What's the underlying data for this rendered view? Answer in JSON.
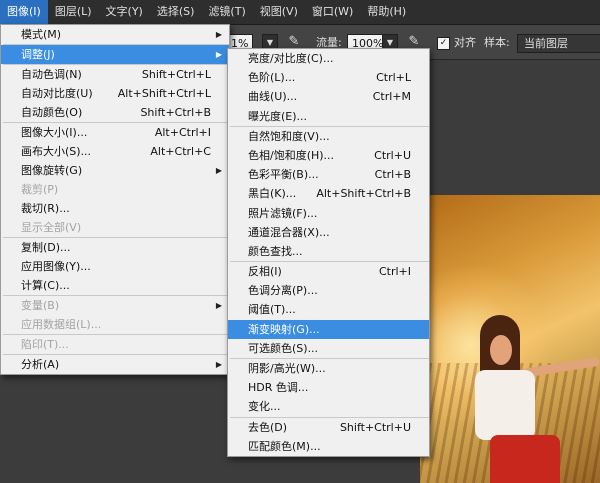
{
  "menubar": [
    {
      "label": "图像(I)",
      "active": true
    },
    {
      "label": "图层(L)",
      "active": false
    },
    {
      "label": "文字(Y)",
      "active": false
    },
    {
      "label": "选择(S)",
      "active": false
    },
    {
      "label": "滤镜(T)",
      "active": false
    },
    {
      "label": "视图(V)",
      "active": false
    },
    {
      "label": "窗口(W)",
      "active": false
    },
    {
      "label": "帮助(H)",
      "active": false
    }
  ],
  "options": {
    "opacity_value": "1%",
    "flow_label": "流量:",
    "flow_value": "100%",
    "align_label": "对齐",
    "align_checked": "✓",
    "sample_label": "样本:",
    "sample_value": "当前图层",
    "airbrush_icon": "airbrush-icon"
  },
  "image_menu": [
    {
      "type": "item",
      "label": "模式(M)",
      "arrow": true
    },
    {
      "type": "sep"
    },
    {
      "type": "item",
      "label": "调整(J)",
      "arrow": true,
      "hl": true
    },
    {
      "type": "sep"
    },
    {
      "type": "item",
      "label": "自动色调(N)",
      "shortcut": "Shift+Ctrl+L"
    },
    {
      "type": "item",
      "label": "自动对比度(U)",
      "shortcut": "Alt+Shift+Ctrl+L"
    },
    {
      "type": "item",
      "label": "自动颜色(O)",
      "shortcut": "Shift+Ctrl+B"
    },
    {
      "type": "sep"
    },
    {
      "type": "item",
      "label": "图像大小(I)...",
      "shortcut": "Alt+Ctrl+I"
    },
    {
      "type": "item",
      "label": "画布大小(S)...",
      "shortcut": "Alt+Ctrl+C"
    },
    {
      "type": "item",
      "label": "图像旋转(G)",
      "arrow": true
    },
    {
      "type": "item",
      "label": "裁剪(P)",
      "disabled": true
    },
    {
      "type": "item",
      "label": "裁切(R)..."
    },
    {
      "type": "item",
      "label": "显示全部(V)",
      "disabled": true
    },
    {
      "type": "sep"
    },
    {
      "type": "item",
      "label": "复制(D)..."
    },
    {
      "type": "item",
      "label": "应用图像(Y)..."
    },
    {
      "type": "item",
      "label": "计算(C)..."
    },
    {
      "type": "sep"
    },
    {
      "type": "item",
      "label": "变量(B)",
      "arrow": true,
      "disabled": true
    },
    {
      "type": "item",
      "label": "应用数据组(L)...",
      "disabled": true
    },
    {
      "type": "sep"
    },
    {
      "type": "item",
      "label": "陷印(T)...",
      "disabled": true
    },
    {
      "type": "sep"
    },
    {
      "type": "item",
      "label": "分析(A)",
      "arrow": true
    }
  ],
  "adjust_menu": [
    {
      "type": "item",
      "label": "亮度/对比度(C)..."
    },
    {
      "type": "item",
      "label": "色阶(L)...",
      "shortcut": "Ctrl+L"
    },
    {
      "type": "item",
      "label": "曲线(U)...",
      "shortcut": "Ctrl+M"
    },
    {
      "type": "item",
      "label": "曝光度(E)..."
    },
    {
      "type": "sep"
    },
    {
      "type": "item",
      "label": "自然饱和度(V)..."
    },
    {
      "type": "item",
      "label": "色相/饱和度(H)...",
      "shortcut": "Ctrl+U"
    },
    {
      "type": "item",
      "label": "色彩平衡(B)...",
      "shortcut": "Ctrl+B"
    },
    {
      "type": "item",
      "label": "黑白(K)...",
      "shortcut": "Alt+Shift+Ctrl+B"
    },
    {
      "type": "item",
      "label": "照片滤镜(F)..."
    },
    {
      "type": "item",
      "label": "通道混合器(X)..."
    },
    {
      "type": "item",
      "label": "颜色查找..."
    },
    {
      "type": "sep"
    },
    {
      "type": "item",
      "label": "反相(I)",
      "shortcut": "Ctrl+I"
    },
    {
      "type": "item",
      "label": "色调分离(P)..."
    },
    {
      "type": "item",
      "label": "阈值(T)..."
    },
    {
      "type": "item",
      "label": "渐变映射(G)...",
      "hl": true
    },
    {
      "type": "item",
      "label": "可选颜色(S)..."
    },
    {
      "type": "sep"
    },
    {
      "type": "item",
      "label": "阴影/高光(W)..."
    },
    {
      "type": "item",
      "label": "HDR 色调..."
    },
    {
      "type": "item",
      "label": "变化..."
    },
    {
      "type": "sep"
    },
    {
      "type": "item",
      "label": "去色(D)",
      "shortcut": "Shift+Ctrl+U"
    },
    {
      "type": "item",
      "label": "匹配颜色(M)..."
    }
  ],
  "colors": {
    "highlight": "#3a8de0",
    "menubar_active": "#2a6fc0",
    "menu_bg": "#f0f0f0",
    "disabled_text": "#a3a3a3"
  }
}
